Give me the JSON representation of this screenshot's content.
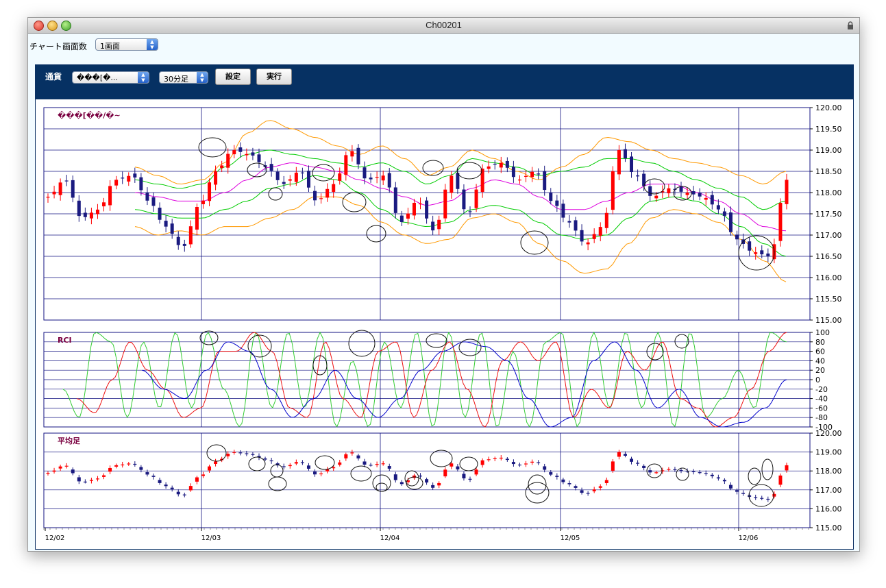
{
  "window": {
    "title": "Ch00201"
  },
  "top": {
    "screen_count_label": "チャート画面数",
    "screen_count_value": "1画面"
  },
  "toolbar": {
    "currency_label": "通貨",
    "currency_value": "���[�...",
    "timeframe_value": "30分足",
    "settings_label": "設定",
    "execute_label": "実行"
  },
  "colors": {
    "window_bg": "#f2fbff",
    "toolbar_bg": "#063163",
    "frame": "#101080",
    "candle_up": "#ff0000",
    "candle_down": "#1a1a80",
    "bb_outer": "#ff9900",
    "bb_inner": "#00cc00",
    "ma": "#dd00dd",
    "rci_short": "#33cc33",
    "rci_mid": "#ee1111",
    "rci_long": "#0000cc"
  },
  "chart_data": [
    {
      "type": "candlestick",
      "title": "���[��/�~",
      "overlays": [
        "bollinger-outer",
        "bollinger-inner",
        "moving-average"
      ],
      "x_ticks": [
        "12/02",
        "12/03",
        "12/04",
        "12/05",
        "12/06"
      ],
      "y_ticks": [
        "120.00",
        "119.50",
        "119.00",
        "118.50",
        "118.00",
        "117.50",
        "117.00",
        "116.50",
        "116.00",
        "115.50",
        "115.00"
      ],
      "ylim": [
        115.0,
        120.0
      ],
      "grid": true,
      "anchors": [
        117.9,
        118.3,
        117.4,
        117.6,
        118.3,
        118.4,
        117.8,
        117.2,
        116.7,
        117.7,
        118.5,
        119.0,
        118.9,
        118.6,
        118.2,
        118.5,
        117.8,
        118.2,
        119.0,
        118.3,
        118.4,
        117.3,
        117.8,
        117.1,
        118.4,
        117.5,
        118.6,
        118.7,
        118.3,
        118.5,
        117.8,
        117.3,
        116.8,
        117.2,
        119.0,
        118.4,
        117.9,
        118.1,
        118.0,
        117.9,
        117.6,
        116.9,
        116.6,
        116.5,
        118.3
      ],
      "bollinger_outer_upper": [
        118.6,
        118.4,
        118.2,
        118.3,
        118.7,
        119.4,
        119.7,
        119.5,
        119.3,
        119.1,
        118.9,
        119.1,
        118.8,
        118.4,
        118.6,
        119.0,
        118.8,
        118.5,
        118.3,
        118.6,
        118.9,
        119.3,
        119.2,
        119.0,
        118.8,
        118.7,
        118.6,
        118.4,
        118.2,
        118.5
      ],
      "bollinger_outer_lower": [
        117.2,
        117.0,
        117.1,
        117.0,
        117.2,
        117.2,
        117.4,
        117.6,
        117.9,
        117.9,
        117.7,
        117.3,
        117.0,
        116.8,
        116.9,
        117.4,
        117.5,
        117.3,
        116.8,
        116.4,
        116.1,
        116.2,
        116.8,
        117.4,
        117.6,
        117.5,
        117.3,
        116.9,
        116.4,
        115.9
      ],
      "bollinger_inner_upper": [
        118.3,
        118.2,
        118.1,
        118.2,
        118.6,
        118.9,
        119.0,
        118.9,
        118.8,
        118.7,
        118.6,
        118.7,
        118.5,
        118.2,
        118.4,
        118.8,
        118.7,
        118.6,
        118.4,
        118.5,
        118.6,
        118.8,
        118.8,
        118.7,
        118.5,
        118.3,
        118.1,
        117.9,
        117.6,
        117.8
      ],
      "bollinger_inner_lower": [
        117.6,
        117.5,
        117.4,
        117.4,
        117.6,
        117.8,
        118.1,
        118.2,
        118.4,
        118.3,
        118.0,
        117.6,
        117.3,
        117.2,
        117.3,
        117.6,
        117.7,
        117.6,
        117.3,
        117.0,
        116.9,
        117.0,
        117.4,
        117.8,
        117.9,
        117.8,
        117.5,
        117.2,
        116.8,
        116.5
      ],
      "moving_average": [
        118.0,
        117.9,
        117.8,
        117.8,
        118.0,
        118.3,
        118.6,
        118.7,
        118.6,
        118.5,
        118.3,
        118.1,
        117.9,
        117.7,
        117.8,
        118.1,
        118.3,
        118.2,
        117.9,
        117.6,
        117.6,
        117.8,
        118.0,
        118.2,
        118.2,
        118.0,
        117.8,
        117.5,
        117.2,
        117.1
      ]
    },
    {
      "type": "line",
      "title": "RCI",
      "y_ticks": [
        "100",
        "80",
        "60",
        "40",
        "20",
        "0",
        "-20",
        "-40",
        "-60",
        "-80",
        "-100"
      ],
      "ylim": [
        -100,
        100
      ],
      "grid": true,
      "series": [
        {
          "key": "short",
          "values": [
            -20,
            -80,
            100,
            80,
            -80,
            80,
            -60,
            100,
            -60,
            100,
            -20,
            -100,
            100,
            -60,
            100,
            -60,
            100,
            -100,
            40,
            -100,
            80,
            -60,
            100,
            -100,
            100,
            -80,
            100,
            -100,
            60,
            -100,
            80,
            100,
            -100,
            100,
            -60,
            100,
            -60,
            100,
            -100,
            100,
            -80,
            -40,
            20,
            -60,
            100,
            80
          ]
        },
        {
          "key": "mid",
          "values": [
            -40,
            -70,
            0,
            80,
            20,
            -20,
            -80,
            -60,
            60,
            60,
            100,
            60,
            -60,
            -80,
            80,
            -40,
            -80,
            60,
            80,
            -80,
            20,
            80,
            -20,
            -100,
            40,
            80,
            40,
            80,
            -80,
            -20,
            -60,
            60,
            20,
            80,
            -40,
            -60,
            -100,
            -80,
            -20,
            60,
            100
          ]
        },
        {
          "key": "long",
          "values": [
            20,
            -20,
            -40,
            20,
            80,
            60,
            -20,
            -80,
            -40,
            20,
            -40,
            -80,
            -40,
            20,
            60,
            80,
            70,
            40,
            -40,
            -100,
            -80,
            40,
            80,
            20,
            -60,
            -20,
            -80,
            -100,
            -90,
            -60,
            0
          ]
        }
      ]
    },
    {
      "type": "candlestick",
      "title": "平均足",
      "y_ticks": [
        "120.00",
        "119.00",
        "118.00",
        "117.00",
        "116.00",
        "115.00"
      ],
      "ylim": [
        115.0,
        120.0
      ],
      "grid": true
    }
  ]
}
